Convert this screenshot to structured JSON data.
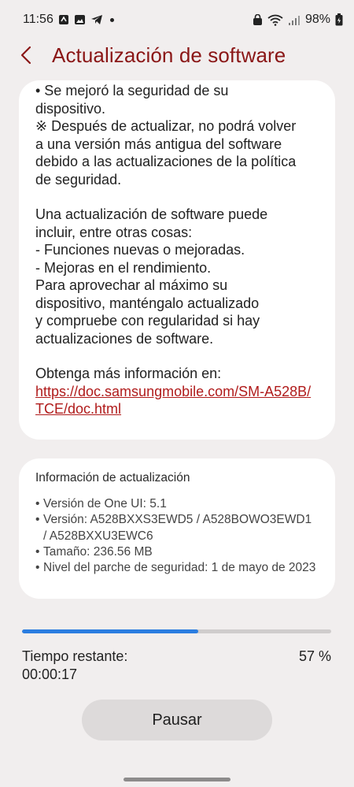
{
  "status_bar": {
    "time": "11:56",
    "battery": "98%",
    "icons": [
      "data-transfer-icon",
      "gallery-icon",
      "telegram-icon",
      "notification-dot-icon",
      "vpn-lock-icon",
      "wifi-icon",
      "signal-icon",
      "battery-icon"
    ]
  },
  "header": {
    "title": "Actualización de software",
    "back_icon": "chevron-left-icon",
    "accent_color": "#8a1616"
  },
  "release_notes": {
    "paragraph1": "• Se mejoró la seguridad de su\ndispositivo.\n※ Después de actualizar, no podrá volver\na una versión más antigua del software\ndebido a las actualizaciones de la política\nde seguridad.",
    "paragraph2": "Una actualización de software puede\nincluir, entre otras cosas:\n - Funciones nuevas o mejoradas.\n - Mejoras en el rendimiento.\nPara aprovechar al máximo su\ndispositivo, manténgalo actualizado\ny compruebe con regularidad si hay\nactualizaciones de software.",
    "more_info_label": "Obtenga más información en:",
    "more_info_link": "https://doc.samsungmobile.com/SM-A528B/TCE/doc.html",
    "link_color": "#b01b1b"
  },
  "update_info": {
    "title": "Información de actualización",
    "items": [
      "Versión de One UI: 5.1",
      "Versión: A528BXXS3EWD5 / A528BOWO3EWD1 / A528BXXU3EWC6",
      "Tamaño: 236.56 MB",
      "Nivel del parche de seguridad: 1 de mayo de 2023"
    ]
  },
  "progress": {
    "fraction": 0.57,
    "percent_label": "57 %",
    "remaining_label": "Tiempo restante:",
    "remaining_time": "00:00:17",
    "bar_color": "#2b7de0"
  },
  "actions": {
    "pause_label": "Pausar"
  }
}
